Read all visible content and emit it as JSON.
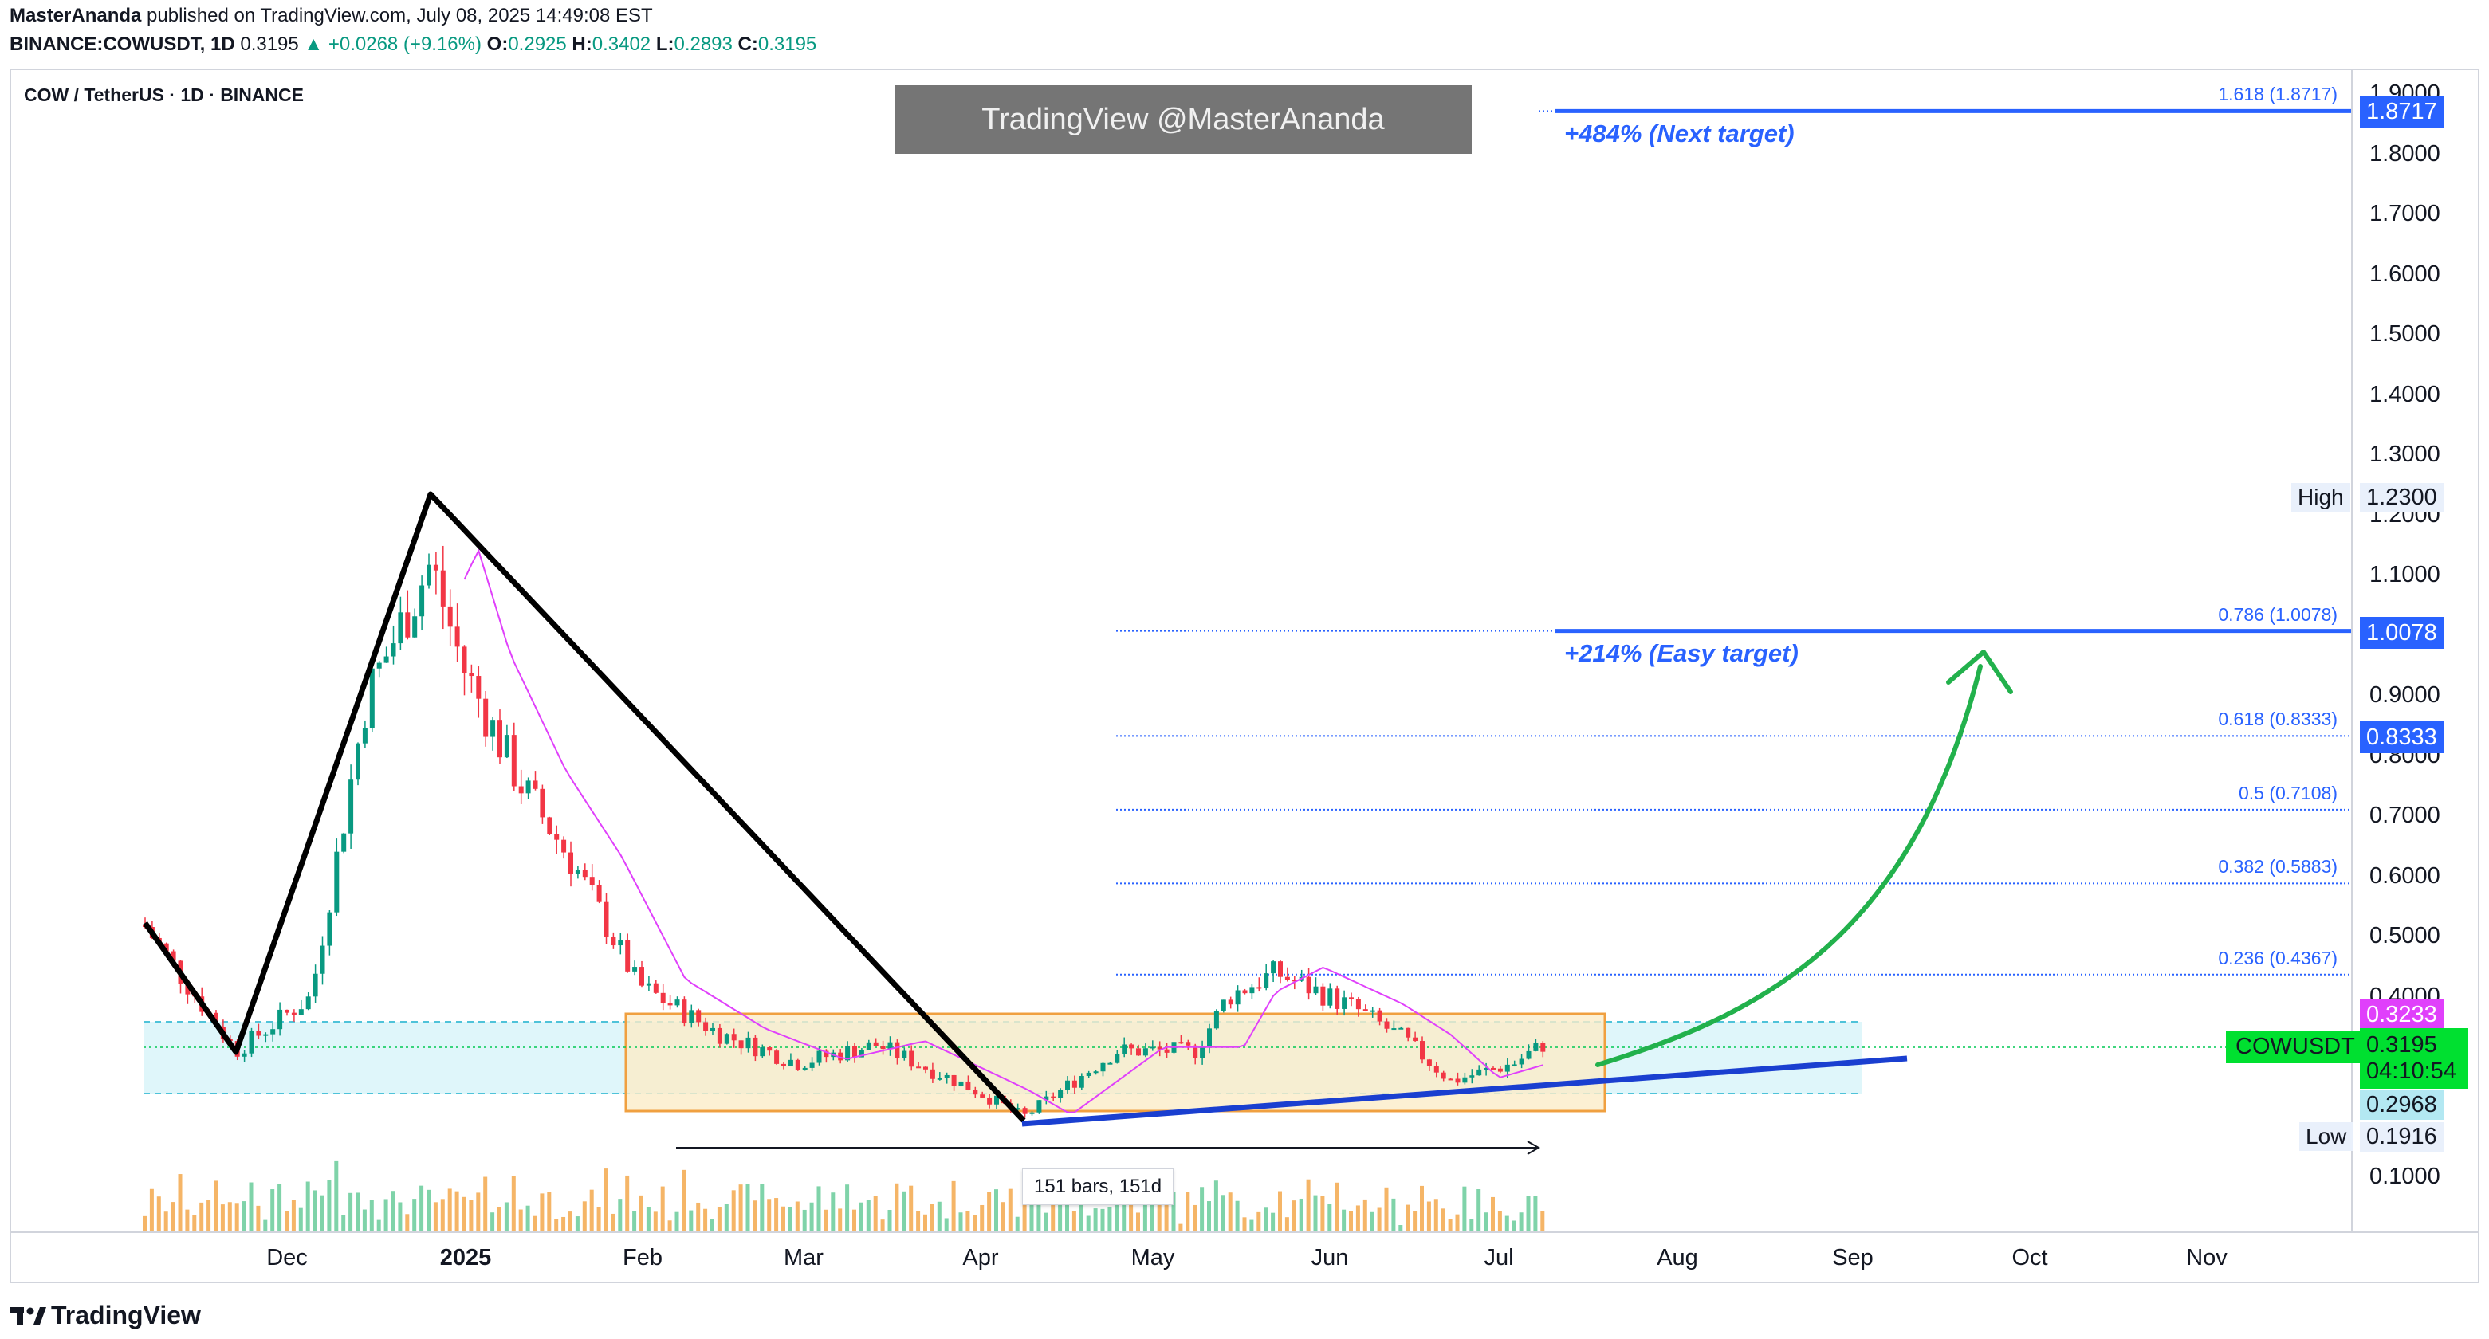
{
  "header": {
    "author": "MasterAnanda",
    "published": "published on TradingView.com, July 08, 2025 14:49:08 EST",
    "symbol": "BINANCE:COWUSDT, 1D",
    "last": "0.3195",
    "change": "▲ +0.0268 (+9.16%)",
    "o_label": "O:",
    "o": "0.2925",
    "h_label": "H:",
    "h": "0.3402",
    "l_label": "L:",
    "l": "0.2893",
    "c_label": "C:",
    "c": "0.3195"
  },
  "pair_title": "COW / TetherUS · 1D · BINANCE",
  "watermark": "TradingView @MasterAnanda",
  "y_ticks": [
    "1.9000",
    "1.8000",
    "1.7000",
    "1.6000",
    "1.5000",
    "1.4000",
    "1.3000",
    "1.2000",
    "1.1000",
    "1.0000",
    "0.9000",
    "0.8000",
    "0.7000",
    "0.6000",
    "0.5000",
    "0.4000",
    "0.1000"
  ],
  "x_ticks": [
    {
      "label": "Dec",
      "bold": false
    },
    {
      "label": "2025",
      "bold": true
    },
    {
      "label": "Feb",
      "bold": false
    },
    {
      "label": "Mar",
      "bold": false
    },
    {
      "label": "Apr",
      "bold": false
    },
    {
      "label": "May",
      "bold": false
    },
    {
      "label": "Jun",
      "bold": false
    },
    {
      "label": "Jul",
      "bold": false
    },
    {
      "label": "Aug",
      "bold": false
    },
    {
      "label": "Sep",
      "bold": false
    },
    {
      "label": "Oct",
      "bold": false
    },
    {
      "label": "Nov",
      "bold": false
    }
  ],
  "fib_levels": [
    {
      "label": "1.618 (1.8717)",
      "price": 1.8717
    },
    {
      "label": "0.786 (1.0078)",
      "price": 1.0078
    },
    {
      "label": "0.618 (0.8333)",
      "price": 0.8333
    },
    {
      "label": "0.5 (0.7108)",
      "price": 0.7108
    },
    {
      "label": "0.382 (0.5883)",
      "price": 0.5883
    },
    {
      "label": "0.236 (0.4367)",
      "price": 0.4367
    }
  ],
  "targets": {
    "next": "+484% (Next target)",
    "easy": "+214% (Easy target)"
  },
  "price_badges": {
    "next_target": "1.8717",
    "easy_target": "1.0078",
    "fib_0618": "0.8333",
    "ma": "0.3233",
    "support": "0.2968"
  },
  "high": {
    "label": "High",
    "value": "1.2300"
  },
  "low": {
    "label": "Low",
    "value": "0.1916"
  },
  "current": {
    "symbol": "COWUSDT",
    "price": "0.3195",
    "countdown": "04:10:54"
  },
  "measure": "151 bars, 151d",
  "brand": "TradingView",
  "colors": {
    "fib": "#2962ff",
    "trend_line": "#1a3fd0",
    "arrow": "#22b14c",
    "up": "#089981",
    "down": "#f23645",
    "ma": "#e040fb",
    "box_border": "#f0a040",
    "box_fill": "#fbecc8",
    "zone_fill": "#dff6fa"
  }
}
